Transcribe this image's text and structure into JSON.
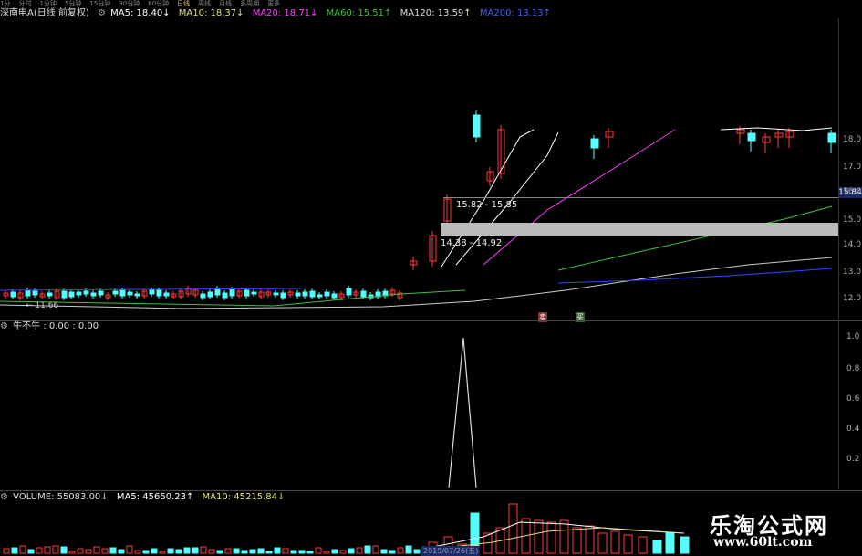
{
  "toolbar": {
    "items": [
      "1分",
      "分时",
      "1分钟",
      "5分钟",
      "15分钟",
      "30分钟",
      "60分钟",
      "日线",
      "周线",
      "月线",
      "多周期",
      "更多"
    ],
    "active_index": 7
  },
  "main_legend": {
    "stock": "深南电A(日线 前复权)",
    "ma5": "MA5: 18.40↓",
    "ma10": "MA10: 18.37↓",
    "ma20": "MA20: 18.71↓",
    "ma60": "MA60: 15.51↑",
    "ma120": "MA120: 13.59↑",
    "ma200": "MA200: 13.13↑"
  },
  "main_axis": {
    "labels": [
      "18.0",
      "17.0",
      "16.0",
      "15.0",
      "14.0",
      "13.0",
      "12.0"
    ],
    "current": "15.84"
  },
  "annotations": {
    "range_high": "15.82 - 15.85",
    "range_low": "14.38 - 14.92",
    "low_price": "11.66",
    "sell_marker": "卖",
    "buy_marker": "买"
  },
  "indicator": {
    "legend": "牛不牛 : 0.00 : 0.00",
    "axis": [
      "1.0",
      "0.8",
      "0.6",
      "0.4",
      "0.2"
    ]
  },
  "volume": {
    "volume": "VOLUME: 55083.00↓",
    "ma5": "MA5: 45650.23↑",
    "ma10": "MA10: 45215.84↓",
    "date_label": "2019/07/26(五)"
  },
  "watermark": {
    "line1": "乐淘公式网",
    "line2": "www.60lt.com"
  },
  "colors": {
    "up": "#ff3b3b",
    "down": "#54ffff",
    "ma5": "#ffffff",
    "ma10": "#e0e080",
    "ma20": "#ff40ff",
    "ma60": "#40c040",
    "ma120": "#cccccc",
    "ma200": "#4040ff"
  }
}
